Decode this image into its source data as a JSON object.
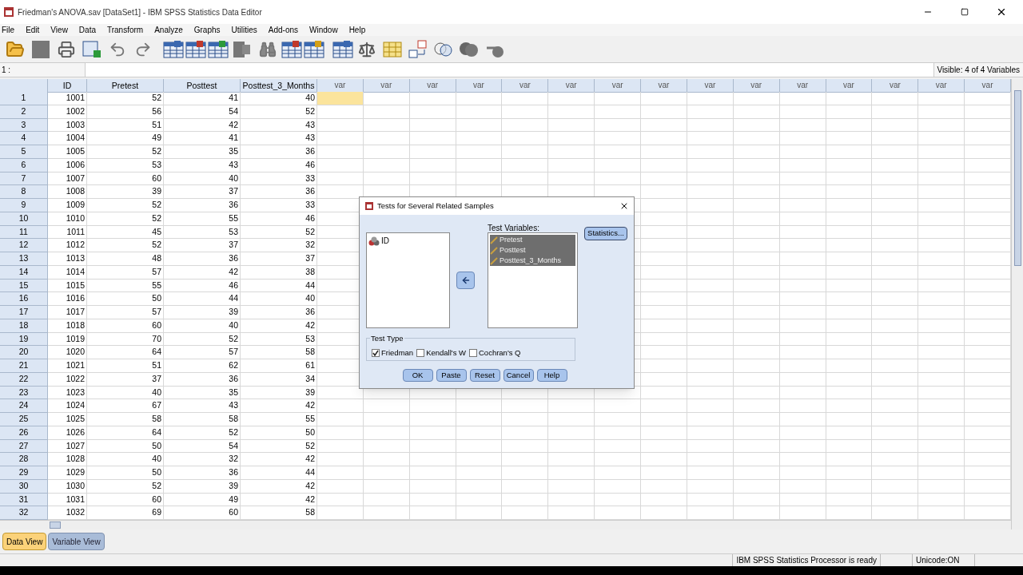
{
  "window": {
    "title": "Friedman's ANOVA.sav [DataSet1] - IBM SPSS Statistics Data Editor"
  },
  "menu": [
    "File",
    "Edit",
    "View",
    "Data",
    "Transform",
    "Analyze",
    "Graphs",
    "Utilities",
    "Add-ons",
    "Window",
    "Help"
  ],
  "cell_editor": {
    "label": "1 :",
    "visible_info": "Visible: 4 of 4 Variables"
  },
  "table": {
    "columns": [
      "ID",
      "Pretest",
      "Posttest",
      "Posttest_3_Months"
    ],
    "var_columns": [
      "var",
      "var",
      "var",
      "var",
      "var",
      "var",
      "var",
      "var",
      "var",
      "var",
      "var",
      "var",
      "var",
      "var",
      "var"
    ],
    "rows": [
      {
        "number": "1",
        "cells": [
          "1001",
          "52",
          "41",
          "40"
        ],
        "selected": true
      },
      {
        "number": "2",
        "cells": [
          "1002",
          "56",
          "54",
          "52"
        ],
        "selected": false
      },
      {
        "number": "3",
        "cells": [
          "1003",
          "51",
          "42",
          "43"
        ],
        "selected": false
      },
      {
        "number": "4",
        "cells": [
          "1004",
          "49",
          "41",
          "43"
        ],
        "selected": false
      },
      {
        "number": "5",
        "cells": [
          "1005",
          "52",
          "35",
          "36"
        ],
        "selected": false
      },
      {
        "number": "6",
        "cells": [
          "1006",
          "53",
          "43",
          "46"
        ],
        "selected": false
      },
      {
        "number": "7",
        "cells": [
          "1007",
          "60",
          "40",
          "33"
        ],
        "selected": false
      },
      {
        "number": "8",
        "cells": [
          "1008",
          "39",
          "37",
          "36"
        ],
        "selected": false
      },
      {
        "number": "9",
        "cells": [
          "1009",
          "52",
          "36",
          "33"
        ],
        "selected": false
      },
      {
        "number": "10",
        "cells": [
          "1010",
          "52",
          "55",
          "46"
        ],
        "selected": false
      },
      {
        "number": "11",
        "cells": [
          "1011",
          "45",
          "53",
          "52"
        ],
        "selected": false
      },
      {
        "number": "12",
        "cells": [
          "1012",
          "52",
          "37",
          "32"
        ],
        "selected": false
      },
      {
        "number": "13",
        "cells": [
          "1013",
          "48",
          "36",
          "37"
        ],
        "selected": false
      },
      {
        "number": "14",
        "cells": [
          "1014",
          "57",
          "42",
          "38"
        ],
        "selected": false
      },
      {
        "number": "15",
        "cells": [
          "1015",
          "55",
          "46",
          "44"
        ],
        "selected": false
      },
      {
        "number": "16",
        "cells": [
          "1016",
          "50",
          "44",
          "40"
        ],
        "selected": false
      },
      {
        "number": "17",
        "cells": [
          "1017",
          "57",
          "39",
          "36"
        ],
        "selected": false
      },
      {
        "number": "18",
        "cells": [
          "1018",
          "60",
          "40",
          "42"
        ],
        "selected": false
      },
      {
        "number": "19",
        "cells": [
          "1019",
          "70",
          "52",
          "53"
        ],
        "selected": false
      },
      {
        "number": "20",
        "cells": [
          "1020",
          "64",
          "57",
          "58"
        ],
        "selected": false
      },
      {
        "number": "21",
        "cells": [
          "1021",
          "51",
          "62",
          "61"
        ],
        "selected": false
      },
      {
        "number": "22",
        "cells": [
          "1022",
          "37",
          "36",
          "34"
        ],
        "selected": false
      },
      {
        "number": "23",
        "cells": [
          "1023",
          "40",
          "35",
          "39"
        ],
        "selected": false
      },
      {
        "number": "24",
        "cells": [
          "1024",
          "67",
          "43",
          "42"
        ],
        "selected": false
      },
      {
        "number": "25",
        "cells": [
          "1025",
          "58",
          "58",
          "55"
        ],
        "selected": false
      },
      {
        "number": "26",
        "cells": [
          "1026",
          "64",
          "52",
          "50"
        ],
        "selected": false
      },
      {
        "number": "27",
        "cells": [
          "1027",
          "50",
          "54",
          "52"
        ],
        "selected": false
      },
      {
        "number": "28",
        "cells": [
          "1028",
          "40",
          "32",
          "42"
        ],
        "selected": false
      },
      {
        "number": "29",
        "cells": [
          "1029",
          "50",
          "36",
          "44"
        ],
        "selected": false
      },
      {
        "number": "30",
        "cells": [
          "1030",
          "52",
          "39",
          "42"
        ],
        "selected": false
      },
      {
        "number": "31",
        "cells": [
          "1031",
          "60",
          "49",
          "42"
        ],
        "selected": false
      },
      {
        "number": "32",
        "cells": [
          "1032",
          "69",
          "60",
          "58"
        ],
        "selected": false
      }
    ]
  },
  "dialog": {
    "title": "Tests for Several Related Samples",
    "source_list": [
      {
        "label": "ID",
        "selected": false
      }
    ],
    "test_variables_label": "Test Variables:",
    "test_variables": [
      {
        "label": "Pretest",
        "selected": true
      },
      {
        "label": "Posttest",
        "selected": true
      },
      {
        "label": "Posttest_3_Months",
        "selected": true
      }
    ],
    "statistics_button": "Statistics...",
    "test_type_label": "Test Type",
    "test_types": [
      {
        "label": "Friedman",
        "checked": true
      },
      {
        "label": "Kendall's W",
        "checked": false
      },
      {
        "label": "Cochran's Q",
        "checked": false
      }
    ],
    "buttons": [
      "OK",
      "Paste",
      "Reset",
      "Cancel",
      "Help"
    ]
  },
  "view_tabs": [
    {
      "label": "Data View",
      "selected": true
    },
    {
      "label": "Variable View",
      "selected": false
    }
  ],
  "status_bar": {
    "processor": "IBM SPSS Statistics Processor is ready",
    "unicode": "Unicode:ON"
  }
}
